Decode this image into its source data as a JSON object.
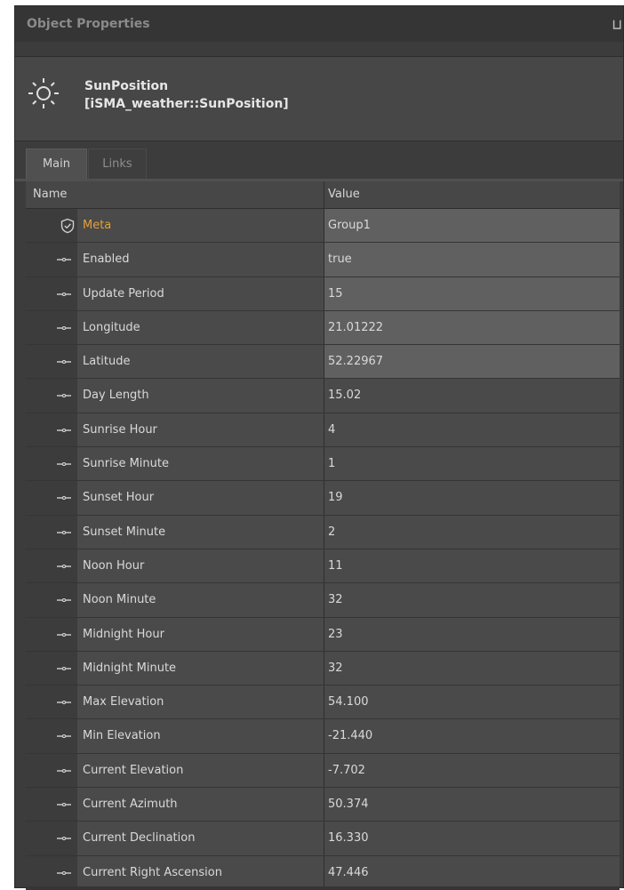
{
  "panel": {
    "title": "Object Properties",
    "pin_glyph": "⨆"
  },
  "object": {
    "icon": "sun-icon",
    "name": "SunPosition",
    "type": "[iSMA_weather::SunPosition]"
  },
  "tabs": [
    {
      "label": "Main",
      "active": true
    },
    {
      "label": "Links",
      "active": false
    }
  ],
  "grid": {
    "columns": {
      "name": "Name",
      "value": "Value"
    },
    "rows": [
      {
        "name": "Meta",
        "value": "Group1",
        "icon": "shield-check-icon",
        "editable": true
      },
      {
        "name": "Enabled",
        "value": "true",
        "icon": "slot-icon",
        "editable": true
      },
      {
        "name": "Update Period",
        "value": "15",
        "icon": "slot-icon",
        "editable": true
      },
      {
        "name": "Longitude",
        "value": "21.01222",
        "icon": "slot-icon",
        "editable": true
      },
      {
        "name": "Latitude",
        "value": "52.22967",
        "icon": "slot-icon",
        "editable": true
      },
      {
        "name": "Day Length",
        "value": "15.02",
        "icon": "slot-icon",
        "editable": false
      },
      {
        "name": "Sunrise Hour",
        "value": "4",
        "icon": "slot-icon",
        "editable": false
      },
      {
        "name": "Sunrise Minute",
        "value": "1",
        "icon": "slot-icon",
        "editable": false
      },
      {
        "name": "Sunset Hour",
        "value": "19",
        "icon": "slot-icon",
        "editable": false
      },
      {
        "name": "Sunset Minute",
        "value": "2",
        "icon": "slot-icon",
        "editable": false
      },
      {
        "name": "Noon Hour",
        "value": "11",
        "icon": "slot-icon",
        "editable": false
      },
      {
        "name": "Noon Minute",
        "value": "32",
        "icon": "slot-icon",
        "editable": false
      },
      {
        "name": "Midnight Hour",
        "value": "23",
        "icon": "slot-icon",
        "editable": false
      },
      {
        "name": "Midnight Minute",
        "value": "32",
        "icon": "slot-icon",
        "editable": false
      },
      {
        "name": "Max Elevation",
        "value": "54.100",
        "icon": "slot-icon",
        "editable": false
      },
      {
        "name": "Min Elevation",
        "value": "-21.440",
        "icon": "slot-icon",
        "editable": false
      },
      {
        "name": "Current Elevation",
        "value": "-7.702",
        "icon": "slot-icon",
        "editable": false
      },
      {
        "name": "Current Azimuth",
        "value": "50.374",
        "icon": "slot-icon",
        "editable": false
      },
      {
        "name": "Current Declination",
        "value": "16.330",
        "icon": "slot-icon",
        "editable": false
      },
      {
        "name": "Current Right Ascension",
        "value": "47.446",
        "icon": "slot-icon",
        "editable": false
      }
    ]
  },
  "colors": {
    "meta_label": "#e3a13a",
    "panel_bg": "#3c3c3c",
    "editable_value_bg": "#606060",
    "readonly_value_bg": "#4a4a4a"
  }
}
